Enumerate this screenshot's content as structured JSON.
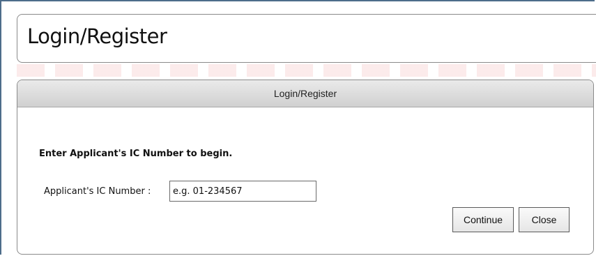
{
  "header": {
    "title": "Login/Register"
  },
  "panel": {
    "title": "Login/Register",
    "instruction": "Enter Applicant's IC Number to begin.",
    "ic_field": {
      "label": "Applicant's IC Number :",
      "placeholder": "e.g. 01-234567",
      "value": ""
    },
    "buttons": {
      "continue_label": "Continue",
      "close_label": "Close"
    }
  }
}
